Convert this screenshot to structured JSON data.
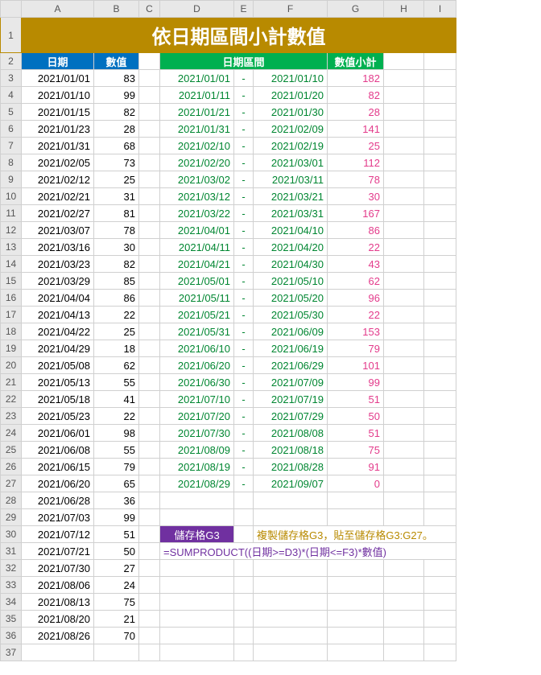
{
  "title": "依日期區間小計數值",
  "headers": {
    "date": "日期",
    "value": "數值",
    "range": "日期區間",
    "subtotal": "數值小計"
  },
  "columns": [
    "A",
    "B",
    "C",
    "D",
    "E",
    "F",
    "G",
    "H",
    "I"
  ],
  "leftRows": [
    {
      "r": 3,
      "date": "2021/01/01",
      "val": 83
    },
    {
      "r": 4,
      "date": "2021/01/10",
      "val": 99
    },
    {
      "r": 5,
      "date": "2021/01/15",
      "val": 82
    },
    {
      "r": 6,
      "date": "2021/01/23",
      "val": 28
    },
    {
      "r": 7,
      "date": "2021/01/31",
      "val": 68
    },
    {
      "r": 8,
      "date": "2021/02/05",
      "val": 73
    },
    {
      "r": 9,
      "date": "2021/02/12",
      "val": 25
    },
    {
      "r": 10,
      "date": "2021/02/21",
      "val": 31
    },
    {
      "r": 11,
      "date": "2021/02/27",
      "val": 81
    },
    {
      "r": 12,
      "date": "2021/03/07",
      "val": 78
    },
    {
      "r": 13,
      "date": "2021/03/16",
      "val": 30
    },
    {
      "r": 14,
      "date": "2021/03/23",
      "val": 82
    },
    {
      "r": 15,
      "date": "2021/03/29",
      "val": 85
    },
    {
      "r": 16,
      "date": "2021/04/04",
      "val": 86
    },
    {
      "r": 17,
      "date": "2021/04/13",
      "val": 22
    },
    {
      "r": 18,
      "date": "2021/04/22",
      "val": 25
    },
    {
      "r": 19,
      "date": "2021/04/29",
      "val": 18
    },
    {
      "r": 20,
      "date": "2021/05/08",
      "val": 62
    },
    {
      "r": 21,
      "date": "2021/05/13",
      "val": 55
    },
    {
      "r": 22,
      "date": "2021/05/18",
      "val": 41
    },
    {
      "r": 23,
      "date": "2021/05/23",
      "val": 22
    },
    {
      "r": 24,
      "date": "2021/06/01",
      "val": 98
    },
    {
      "r": 25,
      "date": "2021/06/08",
      "val": 55
    },
    {
      "r": 26,
      "date": "2021/06/15",
      "val": 79
    },
    {
      "r": 27,
      "date": "2021/06/20",
      "val": 65
    },
    {
      "r": 28,
      "date": "2021/06/28",
      "val": 36
    },
    {
      "r": 29,
      "date": "2021/07/03",
      "val": 99
    },
    {
      "r": 30,
      "date": "2021/07/12",
      "val": 51
    },
    {
      "r": 31,
      "date": "2021/07/21",
      "val": 50
    },
    {
      "r": 32,
      "date": "2021/07/30",
      "val": 27
    },
    {
      "r": 33,
      "date": "2021/08/06",
      "val": 24
    },
    {
      "r": 34,
      "date": "2021/08/13",
      "val": 75
    },
    {
      "r": 35,
      "date": "2021/08/20",
      "val": 21
    },
    {
      "r": 36,
      "date": "2021/08/26",
      "val": 70
    }
  ],
  "rangeRows": [
    {
      "r": 3,
      "from": "2021/01/01",
      "to": "2021/01/10",
      "sum": 182
    },
    {
      "r": 4,
      "from": "2021/01/11",
      "to": "2021/01/20",
      "sum": 82
    },
    {
      "r": 5,
      "from": "2021/01/21",
      "to": "2021/01/30",
      "sum": 28
    },
    {
      "r": 6,
      "from": "2021/01/31",
      "to": "2021/02/09",
      "sum": 141
    },
    {
      "r": 7,
      "from": "2021/02/10",
      "to": "2021/02/19",
      "sum": 25
    },
    {
      "r": 8,
      "from": "2021/02/20",
      "to": "2021/03/01",
      "sum": 112
    },
    {
      "r": 9,
      "from": "2021/03/02",
      "to": "2021/03/11",
      "sum": 78
    },
    {
      "r": 10,
      "from": "2021/03/12",
      "to": "2021/03/21",
      "sum": 30
    },
    {
      "r": 11,
      "from": "2021/03/22",
      "to": "2021/03/31",
      "sum": 167
    },
    {
      "r": 12,
      "from": "2021/04/01",
      "to": "2021/04/10",
      "sum": 86
    },
    {
      "r": 13,
      "from": "2021/04/11",
      "to": "2021/04/20",
      "sum": 22
    },
    {
      "r": 14,
      "from": "2021/04/21",
      "to": "2021/04/30",
      "sum": 43
    },
    {
      "r": 15,
      "from": "2021/05/01",
      "to": "2021/05/10",
      "sum": 62
    },
    {
      "r": 16,
      "from": "2021/05/11",
      "to": "2021/05/20",
      "sum": 96
    },
    {
      "r": 17,
      "from": "2021/05/21",
      "to": "2021/05/30",
      "sum": 22
    },
    {
      "r": 18,
      "from": "2021/05/31",
      "to": "2021/06/09",
      "sum": 153
    },
    {
      "r": 19,
      "from": "2021/06/10",
      "to": "2021/06/19",
      "sum": 79
    },
    {
      "r": 20,
      "from": "2021/06/20",
      "to": "2021/06/29",
      "sum": 101
    },
    {
      "r": 21,
      "from": "2021/06/30",
      "to": "2021/07/09",
      "sum": 99
    },
    {
      "r": 22,
      "from": "2021/07/10",
      "to": "2021/07/19",
      "sum": 51
    },
    {
      "r": 23,
      "from": "2021/07/20",
      "to": "2021/07/29",
      "sum": 50
    },
    {
      "r": 24,
      "from": "2021/07/30",
      "to": "2021/08/08",
      "sum": 51
    },
    {
      "r": 25,
      "from": "2021/08/09",
      "to": "2021/08/18",
      "sum": 75
    },
    {
      "r": 26,
      "from": "2021/08/19",
      "to": "2021/08/28",
      "sum": 91
    },
    {
      "r": 27,
      "from": "2021/08/29",
      "to": "2021/09/07",
      "sum": 0
    }
  ],
  "dash": "-",
  "note": {
    "cellLabel": "儲存格G3",
    "copyText": "複製儲存格G3，貼至儲存格G3:G27。",
    "formula": "=SUMPRODUCT((日期>=D3)*(日期<=F3)*數值)"
  }
}
